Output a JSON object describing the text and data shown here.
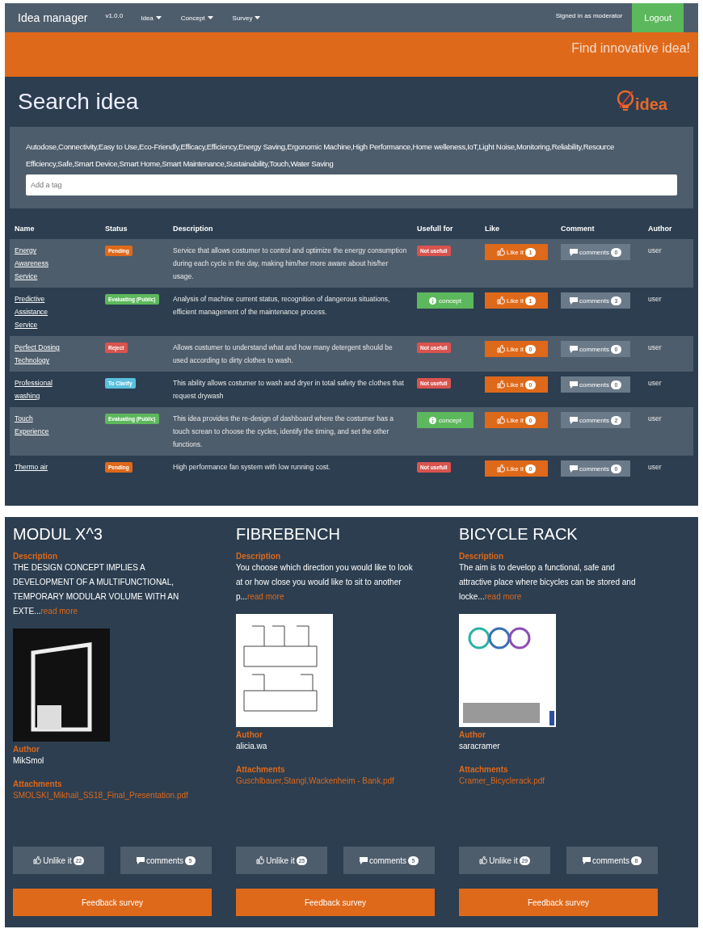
{
  "navbar": {
    "brand": "Idea manager",
    "version": "v1.0.0",
    "menus": [
      {
        "label": "Idea"
      },
      {
        "label": "Concept"
      },
      {
        "label": "Survey"
      }
    ],
    "signed_in": "Signed in as moderator",
    "logout": "Logout"
  },
  "banner": {
    "text": "Find innovative idea!"
  },
  "search": {
    "title": "Search idea",
    "logo": "idea",
    "tags": "Autodose,Connectivity,Easy to Use,Eco-Friendly,Efficacy,Efficiency,Energy Saving,Ergonomic Machine,High Performance,Home welleness,IoT,Light Noise,Monitoring,Reliability,Resource Efficiency,Safe,Smart Device,Smart Home,Smart Maintenance,Sustainability,Touch,Water Saving",
    "placeholder": "Add a tag"
  },
  "table": {
    "columns": [
      "Name",
      "Status",
      "Description",
      "Usefull for",
      "Like",
      "Comment",
      "Author"
    ],
    "rows": [
      {
        "name": "Energy Awareness Service",
        "status": {
          "kind": "pending",
          "label": "Pending"
        },
        "description": "Service that allows costumer to control and optimize the energy consumption during each cycle in the day, making him/her more aware about his/her usage.",
        "useful": {
          "kind": "not_useful",
          "label": "Not usefull"
        },
        "like": {
          "label": "Like it",
          "count": "1"
        },
        "comment": {
          "label": "comments",
          "count": "0"
        },
        "author": "user"
      },
      {
        "name": "Predictive Assistance Service",
        "status": {
          "kind": "evaluating",
          "label": "Evaluating (Public)"
        },
        "description": "Analysis of machine current status, recognition of dangerous situations, efficient management of the maintenance process.",
        "useful": {
          "kind": "concept",
          "label": "concept"
        },
        "like": {
          "label": "Like it",
          "count": "1"
        },
        "comment": {
          "label": "comments",
          "count": "3"
        },
        "author": "user"
      },
      {
        "name": "Perfect Dosing Technology",
        "status": {
          "kind": "reject",
          "label": "Reject"
        },
        "description": "Allows custumer to understand what and how many detergent should be used according to dirty clothes to wash.",
        "useful": {
          "kind": "not_useful",
          "label": "Not usefull"
        },
        "like": {
          "label": "Like it",
          "count": "0"
        },
        "comment": {
          "label": "comments",
          "count": "0"
        },
        "author": "user"
      },
      {
        "name": "Professional washing",
        "status": {
          "kind": "clarify",
          "label": "To Clarify"
        },
        "description": "This ability allows costumer to wash and dryer in total safety the clothes that request drywash",
        "useful": {
          "kind": "not_useful",
          "label": "Not usefull"
        },
        "like": {
          "label": "Like it",
          "count": "0"
        },
        "comment": {
          "label": "comments",
          "count": "0"
        },
        "author": "user"
      },
      {
        "name": "Touch Experience",
        "status": {
          "kind": "evaluating",
          "label": "Evaluating (Public)"
        },
        "description": "This idea provides the re-design of dashboard where the costumer has a touch screan to choose the cycles, identify the timing, and set the other functions.",
        "useful": {
          "kind": "concept",
          "label": "concept"
        },
        "like": {
          "label": "Like it",
          "count": "0"
        },
        "comment": {
          "label": "comments",
          "count": "2"
        },
        "author": "user"
      },
      {
        "name": "Thermo air",
        "status": {
          "kind": "pending",
          "label": "Pending"
        },
        "description": "High performance fan system with low running cost.",
        "useful": {
          "kind": "not_useful",
          "label": "Not usefull"
        },
        "like": {
          "label": "Like it",
          "count": "0"
        },
        "comment": {
          "label": "comments",
          "count": "0"
        },
        "author": "user"
      }
    ]
  },
  "cards": [
    {
      "title": "MODUL X^3",
      "description_label": "Description",
      "description": "THE DESIGN CONCEPT IMPLIES A DEVELOPMENT OF A MULTIFUNCTIONAL, TEMPORARY MODULAR VOLUME WITH AN EXTE...",
      "read_more": "read more",
      "kind": "photo",
      "author_label": "Author",
      "author": "MikSmol",
      "attachments_label": "Attachments",
      "attachment": "SMOLSKI_Mikhail_SS18_Final_Presentation.pdf",
      "unlike": {
        "label": "Unlike it",
        "count": "22"
      },
      "comments": {
        "label": "comments",
        "count": "5"
      },
      "survey": "Feedback survey"
    },
    {
      "title": "FIBREBENCH",
      "description_label": "Description",
      "description": "You choose which direction you would like to look at or how close you would like to sit to another p...",
      "read_more": "read more",
      "kind": "sketch",
      "author_label": "Author",
      "author": "alicia.wa",
      "attachments_label": "Attachments",
      "attachment": "Guschlbauer,Stangl,Wackenheim - Bank.pdf",
      "unlike": {
        "label": "Unlike it",
        "count": "25"
      },
      "comments": {
        "label": "comments",
        "count": "5"
      },
      "survey": "Feedback survey"
    },
    {
      "title": "BICYCLE RACK",
      "description_label": "Description",
      "description": "The aim is to develop a functional, safe and attractive place where bicycles can be stored and locke...",
      "read_more": "read more",
      "kind": "poster",
      "author_label": "Author",
      "author": "saracramer",
      "attachments_label": "Attachments",
      "attachment": "Cramer_Bicyclerack.pdf",
      "unlike": {
        "label": "Unlike it",
        "count": "29"
      },
      "comments": {
        "label": "comments",
        "count": "8"
      },
      "survey": "Feedback survey"
    }
  ]
}
